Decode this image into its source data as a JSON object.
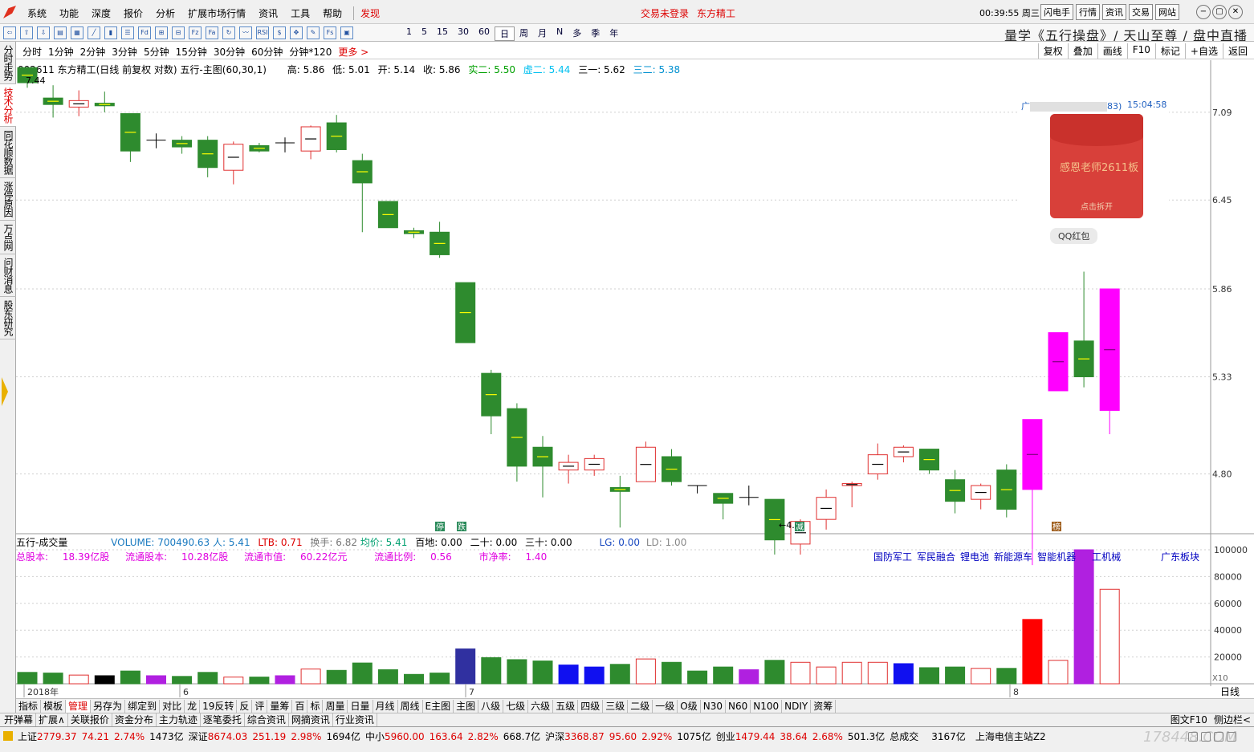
{
  "menubar": {
    "items": [
      "系统",
      "功能",
      "深度",
      "报价",
      "分析",
      "扩展市场行情",
      "资讯",
      "工具",
      "帮助"
    ],
    "discover": "发现",
    "status": [
      "交易未登录",
      "东方精工"
    ],
    "clock": "00:39:55 周三",
    "right_buttons": [
      "闪电手",
      "行情",
      "资讯",
      "交易",
      "网站"
    ]
  },
  "toolbar": {
    "icons": [
      "back-icon",
      "up-icon",
      "down-icon",
      "chart-icon",
      "grid-icon",
      "line-icon",
      "kline-icon",
      "list-icon",
      "fd-icon",
      "calc-icon",
      "f10-icon",
      "fz-icon",
      "fa-icon",
      "refresh-icon",
      "trend-icon",
      "rsi-icon",
      "money-icon",
      "move-icon",
      "pen-icon",
      "fs-icon",
      "stock-icon"
    ],
    "icon_labels": [
      "⇦",
      "⇧",
      "⇩",
      "▤",
      "▦",
      "╱",
      "▮",
      "☰",
      "Fd",
      "⊞",
      "⊟",
      "Fz",
      "Fa",
      "↻",
      "〰",
      "RSI",
      "$",
      "✥",
      "✎",
      "Fs",
      "▣"
    ],
    "periods": [
      "1",
      "5",
      "15",
      "30",
      "60",
      "日",
      "周",
      "月",
      "N",
      "多",
      "季",
      "年"
    ],
    "selected_period": "日",
    "slogan": "量学《五行操盘》/ 天山至尊 / 盘中直播"
  },
  "periodbar": {
    "items": [
      "分时",
      "1分钟",
      "2分钟",
      "3分钟",
      "5分钟",
      "15分钟",
      "30分钟",
      "60分钟",
      "分钟*120"
    ],
    "more": "更多 >",
    "right": [
      "复权",
      "叠加",
      "画线",
      "F10",
      "标记",
      "+自选",
      "返回"
    ]
  },
  "sidebar": {
    "tabs": [
      "分时走势",
      "技术分析",
      "同花顺数据",
      "涨停原因",
      "万点网",
      "问财消息",
      "股东研究"
    ],
    "selected": "技术分析"
  },
  "main_info": {
    "title": "002611 东方精工(日线 前复权 对数) 五行-主图(60,30,1)",
    "high": "高: 5.86",
    "low": "低: 5.01",
    "open": "开: 5.14",
    "close": "收: 5.86",
    "shi2": "实二: 5.50",
    "xu2": "虚二: 5.44",
    "san1": "三一: 5.62",
    "san2": "三二: 5.38",
    "max_label": "7.44",
    "min_label": "←4.",
    "markers": [
      "停",
      "跌",
      "减",
      "榜"
    ]
  },
  "price_axis": [
    "7.09",
    "6.45",
    "5.86",
    "5.33",
    "4.80"
  ],
  "vol_axis": [
    "100000",
    "80000",
    "60000",
    "40000",
    "20000"
  ],
  "vol_scale": "X10",
  "date_axis": [
    "2018年",
    "6",
    "7",
    "8"
  ],
  "right_corner": "日线",
  "right_buttons": [
    "+",
    "−",
    "0"
  ],
  "vol_info": {
    "title": "五行-成交量",
    "volume": "VOLUME: 700490.63",
    "ren": "人: 5.41",
    "ltb": "LTB: 0.71",
    "turnover": "换手: 6.82",
    "avg": "均价: 5.41",
    "baidi": "百地: 0.00",
    "ershi": "二十: 0.00",
    "sanshi": "三十: 0.00",
    "lg": "LG: 0.00",
    "ld": "LD: 1.00"
  },
  "fundamentals": {
    "total_shares_label": "总股本:",
    "total_shares": "18.39亿股",
    "float_shares_label": "流通股本:",
    "float_shares": "10.28亿股",
    "float_mv_label": "流通市值:",
    "float_mv": "60.22亿元",
    "float_ratio_label": "流通比例:",
    "float_ratio": "0.56",
    "pb_label": "市净率:",
    "pb": "1.40"
  },
  "sectors": [
    "国防军工",
    "军民融合",
    "锂电池",
    "新能源车",
    "智能机器",
    "工机械"
  ],
  "sector_right": "广东板块",
  "ad": {
    "header_prefix": "广",
    "header_suffix": "83)",
    "time": "15:04:58",
    "message": "感恩老师2611板",
    "open_label": "点击拆开",
    "qq_label": "QQ红包"
  },
  "tabs1": [
    "指标",
    "模板",
    "管理",
    "另存为",
    "绑定到",
    "对比",
    "龙",
    "19反转",
    "反",
    "评",
    "量筹",
    "百",
    "标",
    "周量",
    "日量",
    "月线",
    "周线",
    "E主图",
    "主图",
    "八级",
    "七级",
    "六级",
    "五级",
    "四级",
    "三级",
    "二级",
    "一级",
    "O级",
    "N30",
    "N60",
    "N100",
    "NDIY",
    "资筹"
  ],
  "tabs1_selected": "管理",
  "tabs2": [
    "开弹幕",
    "扩展∧",
    "关联报价",
    "资金分布",
    "主力轨迹",
    "逐笔委托",
    "综合资讯",
    "网摘资讯",
    "行业资讯"
  ],
  "tabs2_right": [
    "图文F10",
    "侧边栏<"
  ],
  "statusbar": {
    "sh_name": "上证",
    "sh_val": "2779.37",
    "sh_chg": "74.21",
    "sh_pct": "2.74%",
    "sh_amt": "1473亿",
    "sz_name": "深证",
    "sz_val": "8674.03",
    "sz_chg": "251.19",
    "sz_pct": "2.98%",
    "sz_amt": "1694亿",
    "zx_name": "中小",
    "zx_val": "5960.00",
    "zx_chg": "163.64",
    "zx_pct": "2.82%",
    "zx_amt": "668.7亿",
    "hs_name": "沪深",
    "hs_val": "3368.87",
    "hs_chg": "95.60",
    "hs_pct": "2.92%",
    "hs_amt": "1075亿",
    "cy_name": "创业",
    "cy_val": "1479.44",
    "cy_chg": "38.64",
    "cy_pct": "2.68%",
    "cy_amt": "501.3亿",
    "total_label": "总成交",
    "total": "3167亿",
    "server": "上海电信主站Z2",
    "watermark": "178448.COM"
  },
  "chart_data": {
    "type": "candlestick",
    "title": "002611 东方精工(日线 前复权 对数) 五行-主图(60,30,1)",
    "colors": {
      "up": "#e03030",
      "down": "#2e8b2e",
      "limit": "#ff00ff",
      "ma": "#ffff00"
    },
    "price_range": [
      4.5,
      7.5
    ],
    "candles": [
      [
        7.44,
        7.44,
        7.28,
        7.32,
        "g"
      ],
      [
        7.2,
        7.3,
        7.05,
        7.15,
        "g"
      ],
      [
        7.13,
        7.26,
        7.06,
        7.18,
        "r"
      ],
      [
        7.16,
        7.25,
        7.09,
        7.14,
        "g"
      ],
      [
        7.08,
        7.08,
        6.72,
        6.8,
        "g"
      ],
      [
        6.88,
        6.93,
        6.82,
        6.88,
        "x"
      ],
      [
        6.88,
        6.91,
        6.78,
        6.83,
        "g"
      ],
      [
        6.88,
        6.91,
        6.61,
        6.68,
        "g"
      ],
      [
        6.66,
        6.87,
        6.56,
        6.85,
        "r"
      ],
      [
        6.84,
        6.86,
        6.79,
        6.8,
        "g"
      ],
      [
        6.85,
        6.9,
        6.79,
        6.86,
        "x"
      ],
      [
        6.8,
        6.99,
        6.74,
        6.98,
        "r"
      ],
      [
        7.01,
        7.07,
        6.79,
        6.81,
        "g"
      ],
      [
        6.73,
        6.78,
        6.23,
        6.57,
        "g"
      ],
      [
        6.44,
        6.44,
        6.26,
        6.26,
        "g"
      ],
      [
        6.24,
        6.26,
        6.19,
        6.22,
        "g"
      ],
      [
        6.23,
        6.3,
        6.06,
        6.08,
        "g"
      ],
      [
        5.9,
        5.9,
        5.53,
        5.53,
        "g"
      ],
      [
        5.35,
        5.37,
        5.01,
        5.11,
        "g"
      ],
      [
        5.15,
        5.18,
        4.76,
        4.84,
        "g"
      ],
      [
        4.94,
        5.0,
        4.68,
        4.84,
        "g"
      ],
      [
        4.82,
        4.9,
        4.75,
        4.86,
        "r"
      ],
      [
        4.82,
        4.9,
        4.79,
        4.88,
        "r"
      ],
      [
        4.73,
        4.79,
        4.53,
        4.71,
        "g"
      ],
      [
        4.76,
        4.97,
        4.76,
        4.94,
        "r"
      ],
      [
        4.89,
        4.93,
        4.74,
        4.76,
        "g"
      ],
      [
        4.74,
        4.74,
        4.7,
        4.72,
        "x"
      ],
      [
        4.7,
        4.7,
        4.57,
        4.65,
        "g"
      ],
      [
        4.68,
        4.74,
        4.64,
        4.68,
        "x"
      ],
      [
        4.67,
        4.67,
        4.4,
        4.47,
        "g"
      ],
      [
        4.45,
        4.57,
        4.4,
        4.56,
        "r"
      ],
      [
        4.57,
        4.72,
        4.52,
        4.68,
        "r"
      ],
      [
        4.74,
        4.76,
        4.63,
        4.75,
        "r"
      ],
      [
        4.8,
        4.96,
        4.77,
        4.9,
        "r"
      ],
      [
        4.89,
        4.95,
        4.86,
        4.94,
        "r"
      ],
      [
        4.93,
        4.93,
        4.8,
        4.82,
        "g"
      ],
      [
        4.77,
        4.82,
        4.6,
        4.66,
        "g"
      ],
      [
        4.67,
        4.75,
        4.62,
        4.74,
        "r"
      ],
      [
        4.82,
        4.85,
        4.58,
        4.62,
        "g"
      ],
      [
        4.72,
        5.09,
        4.35,
        5.09,
        "m"
      ],
      [
        5.59,
        5.59,
        5.25,
        5.25,
        "m"
      ],
      [
        5.54,
        5.97,
        5.27,
        5.33,
        "g"
      ],
      [
        5.14,
        5.86,
        5.01,
        5.86,
        "m"
      ]
    ],
    "volume_range": [
      0,
      100000
    ],
    "volumes": [
      [
        8500,
        "g"
      ],
      [
        8000,
        "g"
      ],
      [
        6500,
        "r"
      ],
      [
        6000,
        "k"
      ],
      [
        9500,
        "g"
      ],
      [
        6000,
        "p"
      ],
      [
        5500,
        "g"
      ],
      [
        8500,
        "g"
      ],
      [
        5000,
        "r"
      ],
      [
        5000,
        "g"
      ],
      [
        6000,
        "p"
      ],
      [
        11000,
        "r"
      ],
      [
        10000,
        "g"
      ],
      [
        15500,
        "g"
      ],
      [
        10500,
        "g"
      ],
      [
        7000,
        "g"
      ],
      [
        8000,
        "g"
      ],
      [
        26000,
        "n"
      ],
      [
        19500,
        "g"
      ],
      [
        18000,
        "g"
      ],
      [
        17000,
        "g"
      ],
      [
        14000,
        "b"
      ],
      [
        12500,
        "b"
      ],
      [
        14500,
        "g"
      ],
      [
        18500,
        "r"
      ],
      [
        16000,
        "g"
      ],
      [
        9500,
        "g"
      ],
      [
        12500,
        "g"
      ],
      [
        10500,
        "p"
      ],
      [
        17500,
        "g"
      ],
      [
        16000,
        "r"
      ],
      [
        12500,
        "r"
      ],
      [
        16000,
        "r"
      ],
      [
        16000,
        "r"
      ],
      [
        15000,
        "b"
      ],
      [
        12000,
        "g"
      ],
      [
        12500,
        "g"
      ],
      [
        11500,
        "r"
      ],
      [
        11500,
        "g"
      ],
      [
        48000,
        "R"
      ],
      [
        17500,
        "r"
      ],
      [
        100000,
        "P"
      ],
      [
        70500,
        "r"
      ]
    ]
  }
}
